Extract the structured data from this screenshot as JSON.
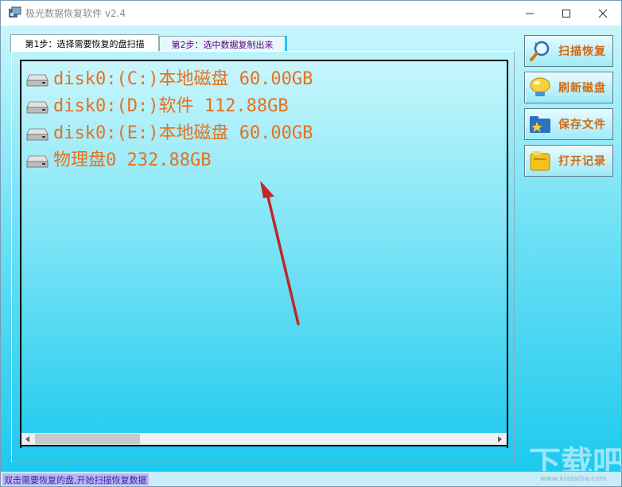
{
  "window": {
    "title": "极光数据恢复软件 v2.4"
  },
  "tabs": [
    {
      "label": "第1步：选择需要恢复的盘扫描"
    },
    {
      "label": "第2步：选中数据复制出来"
    }
  ],
  "disks": [
    {
      "label": "disk0:(C:)本地磁盘 60.00GB"
    },
    {
      "label": "disk0:(D:)软件 112.88GB"
    },
    {
      "label": "disk0:(E:)本地磁盘 60.00GB"
    },
    {
      "label": "物理盘0 232.88GB"
    }
  ],
  "buttons": {
    "scan": "扫描恢复",
    "refresh": "刷新磁盘",
    "save": "保存文件",
    "open_log": "打开记录"
  },
  "status": {
    "text": "双击需要恢复的盘,开始扫描恢复数据"
  },
  "watermark": {
    "site": "www.xiazaiba.com"
  },
  "colors": {
    "disk_label": "#e8701d",
    "button_label": "#d26a10",
    "client_top": "#c8f6fc",
    "client_bottom": "#1ec9ef",
    "annotation_arrow": "#c0262a"
  },
  "icons": {
    "app": "app-logo-icon",
    "disk": "hard-drive-icon",
    "scan": "magnifier-icon",
    "refresh": "refresh-bubble-icon",
    "save": "folder-star-icon",
    "open_log": "yellow-folder-icon"
  }
}
